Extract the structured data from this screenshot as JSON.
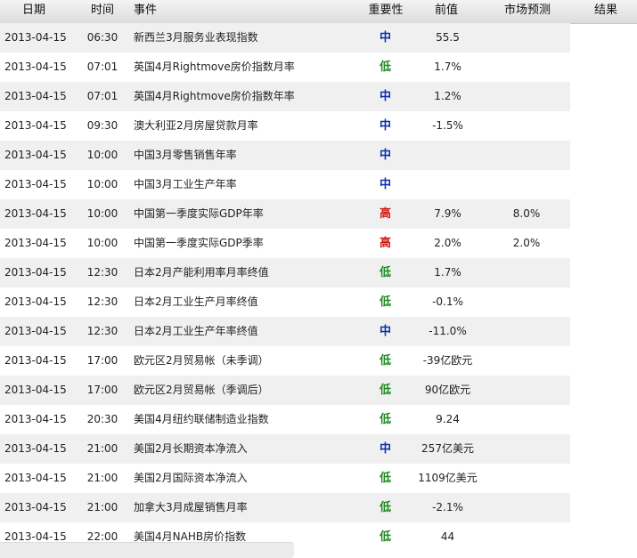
{
  "header": {
    "date": "日期",
    "time": "时间",
    "event": "事件",
    "importance": "重要性",
    "previous": "前值",
    "forecast": "市场预测",
    "result": "结果"
  },
  "colors": {
    "importance_high": "#d0140c",
    "importance_mid": "#0b2fa8",
    "importance_low": "#1f8a1f",
    "row_alt": "#f0f0f0"
  },
  "rows": [
    {
      "date": "2013-04-15",
      "time": "06:30",
      "event": "新西兰3月服务业表现指数",
      "importance": "中",
      "level": "mid",
      "previous": "55.5",
      "forecast": ""
    },
    {
      "date": "2013-04-15",
      "time": "07:01",
      "event": "英国4月Rightmove房价指数月率",
      "importance": "低",
      "level": "low",
      "previous": "1.7%",
      "forecast": ""
    },
    {
      "date": "2013-04-15",
      "time": "07:01",
      "event": "英国4月Rightmove房价指数年率",
      "importance": "中",
      "level": "mid",
      "previous": "1.2%",
      "forecast": ""
    },
    {
      "date": "2013-04-15",
      "time": "09:30",
      "event": "澳大利亚2月房屋贷款月率",
      "importance": "中",
      "level": "mid",
      "previous": "-1.5%",
      "forecast": ""
    },
    {
      "date": "2013-04-15",
      "time": "10:00",
      "event": "中国3月零售销售年率",
      "importance": "中",
      "level": "mid",
      "previous": "",
      "forecast": ""
    },
    {
      "date": "2013-04-15",
      "time": "10:00",
      "event": "中国3月工业生产年率",
      "importance": "中",
      "level": "mid",
      "previous": "",
      "forecast": ""
    },
    {
      "date": "2013-04-15",
      "time": "10:00",
      "event": "中国第一季度实际GDP年率",
      "importance": "高",
      "level": "high",
      "previous": "7.9%",
      "forecast": "8.0%"
    },
    {
      "date": "2013-04-15",
      "time": "10:00",
      "event": "中国第一季度实际GDP季率",
      "importance": "高",
      "level": "high",
      "previous": "2.0%",
      "forecast": "2.0%"
    },
    {
      "date": "2013-04-15",
      "time": "12:30",
      "event": "日本2月产能利用率月率终值",
      "importance": "低",
      "level": "low",
      "previous": "1.7%",
      "forecast": ""
    },
    {
      "date": "2013-04-15",
      "time": "12:30",
      "event": "日本2月工业生产月率终值",
      "importance": "低",
      "level": "low",
      "previous": "-0.1%",
      "forecast": ""
    },
    {
      "date": "2013-04-15",
      "time": "12:30",
      "event": "日本2月工业生产年率终值",
      "importance": "中",
      "level": "mid",
      "previous": "-11.0%",
      "forecast": ""
    },
    {
      "date": "2013-04-15",
      "time": "17:00",
      "event": "欧元区2月贸易帐（未季调）",
      "importance": "低",
      "level": "low",
      "previous": "-39亿欧元",
      "forecast": ""
    },
    {
      "date": "2013-04-15",
      "time": "17:00",
      "event": "欧元区2月贸易帐（季调后）",
      "importance": "低",
      "level": "low",
      "previous": "90亿欧元",
      "forecast": ""
    },
    {
      "date": "2013-04-15",
      "time": "20:30",
      "event": "美国4月纽约联储制造业指数",
      "importance": "低",
      "level": "low",
      "previous": "9.24",
      "forecast": ""
    },
    {
      "date": "2013-04-15",
      "time": "21:00",
      "event": "美国2月长期资本净流入",
      "importance": "中",
      "level": "mid",
      "previous": "257亿美元",
      "forecast": ""
    },
    {
      "date": "2013-04-15",
      "time": "21:00",
      "event": "美国2月国际资本净流入",
      "importance": "低",
      "level": "low",
      "previous": "1109亿美元",
      "forecast": ""
    },
    {
      "date": "2013-04-15",
      "time": "21:00",
      "event": "加拿大3月成屋销售月率",
      "importance": "低",
      "level": "low",
      "previous": "-2.1%",
      "forecast": ""
    },
    {
      "date": "2013-04-15",
      "time": "22:00",
      "event": "美国4月NAHB房价指数",
      "importance": "低",
      "level": "low",
      "previous": "44",
      "forecast": ""
    }
  ]
}
